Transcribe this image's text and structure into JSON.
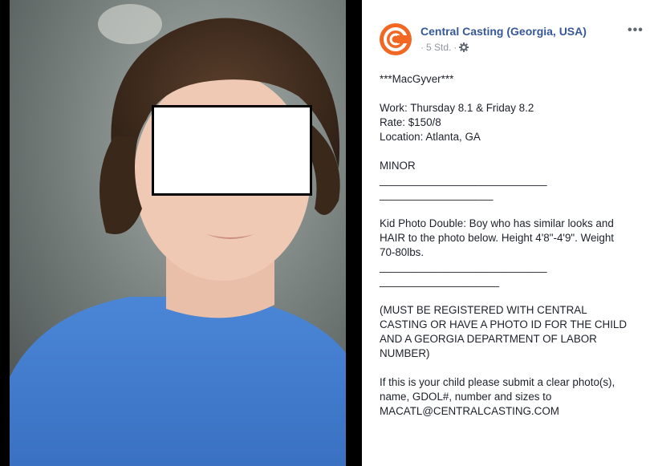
{
  "page": {
    "name": "Central Casting (Georgia, USA)",
    "timestamp": "5 Std.",
    "separator": "·",
    "more": "•••",
    "brand_color": "#f26722",
    "link_color": "#365899"
  },
  "post": {
    "title": "***MacGyver***",
    "work": "Work: Thursday 8.1 & Friday 8.2",
    "rate": "Rate: $150/8",
    "location": "Location: Atlanta, GA",
    "minor": "MINOR",
    "divider1a": "____________________________",
    "divider1b": "___________________",
    "description": [
      "Kid Photo Double: Boy who has similar looks and",
      "HAIR to the photo below. Height 4'8\"-4'9\". Weight",
      "70-80lbs."
    ],
    "divider2a": "____________________________",
    "divider2b": "____________________",
    "requirements": [
      "(MUST BE REGISTERED WITH CENTRAL",
      "CASTING OR HAVE A PHOTO ID FOR THE CHILD",
      "AND A GEORGIA DEPARTMENT OF LABOR",
      "NUMBER)"
    ],
    "instructions": [
      "If this is your child please submit a clear photo(s),",
      "name, GDOL#, number and sizes to",
      "MACATL@CENTRALCASTING.COM"
    ]
  }
}
